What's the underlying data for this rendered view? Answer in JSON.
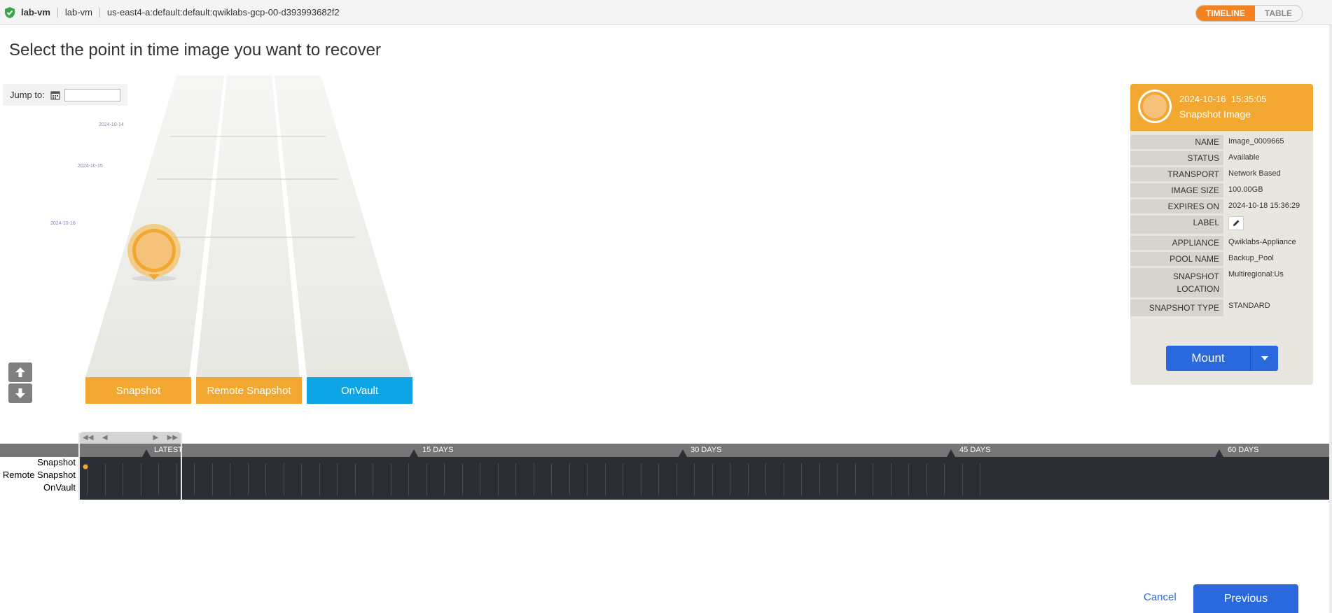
{
  "topbar": {
    "vm_name": "lab-vm",
    "host_name": "lab-vm",
    "resource_path": "us-east4-a:default:default:qwiklabs-gcp-00-d393993682f2",
    "view_toggle": {
      "timeline": "TIMELINE",
      "table": "TABLE",
      "active": "TIMELINE"
    }
  },
  "page_title": "Select the point in time image you want to recover",
  "jump": {
    "label": "Jump to:"
  },
  "track_dates": [
    "2024-10-14",
    "2024-10-15",
    "2024-10-16"
  ],
  "tabs": [
    {
      "label": "Snapshot",
      "color": "#f2a730"
    },
    {
      "label": "Remote Snapshot",
      "color": "#f2a730"
    },
    {
      "label": "OnVault",
      "color": "#0ea5e6"
    }
  ],
  "scrubber": {
    "markers": [
      "LATEST",
      "15 DAYS",
      "30 DAYS",
      "45 DAYS",
      "60 DAYS"
    ],
    "lanes": [
      "Snapshot",
      "Remote Snapshot",
      "OnVault"
    ]
  },
  "detail": {
    "date": "2024-10-16",
    "time": "15:35:05",
    "type": "Snapshot Image",
    "rows": [
      {
        "key": "NAME",
        "value": "Image_0009665"
      },
      {
        "key": "STATUS",
        "value": "Available"
      },
      {
        "key": "TRANSPORT",
        "value": "Network Based"
      },
      {
        "key": "IMAGE SIZE",
        "value": "100.00GB"
      },
      {
        "key": "EXPIRES ON",
        "value": "2024-10-18 15:36:29"
      },
      {
        "key": "LABEL",
        "value": ""
      },
      {
        "key": "APPLIANCE",
        "value": "Qwiklabs-Appliance"
      },
      {
        "key": "POOL NAME",
        "value": "Backup_Pool"
      },
      {
        "key": "SNAPSHOT LOCATION",
        "value": "Multiregional:Us"
      },
      {
        "key": "SNAPSHOT TYPE",
        "value": "STANDARD"
      }
    ],
    "mount_label": "Mount"
  },
  "footer": {
    "cancel": "Cancel",
    "previous": "Previous"
  },
  "colors": {
    "accent": "#f2a730",
    "primary": "#2a68dd",
    "onvault": "#0ea5e6"
  }
}
